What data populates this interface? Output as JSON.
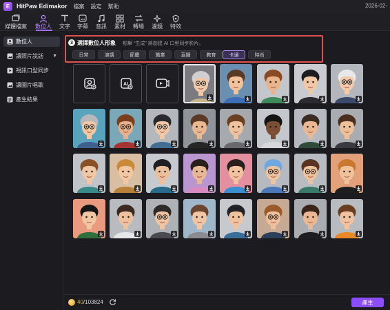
{
  "app": {
    "title": "HitPaw Edimakor",
    "logo_icon": "edimakor-logo",
    "date": "2026-02-"
  },
  "menu": [
    "檔案",
    "設定",
    "幫助"
  ],
  "toolbar": [
    {
      "label": "媒體檔案",
      "icon": "media-files-icon"
    },
    {
      "label": "數位人",
      "icon": "digital-human-icon",
      "active": true
    },
    {
      "label": "文字",
      "icon": "text-icon"
    },
    {
      "label": "字幕",
      "icon": "subtitles-icon"
    },
    {
      "label": "音訊",
      "icon": "audio-icon"
    },
    {
      "label": "素材",
      "icon": "assets-icon"
    },
    {
      "label": "轉場",
      "icon": "transitions-icon"
    },
    {
      "label": "濾鏡",
      "icon": "filters-icon"
    },
    {
      "label": "特效",
      "icon": "effects-icon"
    }
  ],
  "sidebar": [
    {
      "label": "數位人",
      "icon": "digital-human-icon",
      "active": true
    },
    {
      "label": "讓照片說話",
      "icon": "talking-photo-icon",
      "has_caret": true
    },
    {
      "label": "視訊口型同步",
      "icon": "lip-sync-icon"
    },
    {
      "label": "讓圖片唱歌",
      "icon": "singing-photo-icon"
    },
    {
      "label": "產生結果",
      "icon": "results-icon"
    }
  ],
  "selection": {
    "step": "3",
    "title": "選擇數位人形象",
    "hint": "點擊 \"生成\" 將創建 AI 口型同步影片。",
    "categories": [
      {
        "label": "日常"
      },
      {
        "label": "演講"
      },
      {
        "label": "節慶"
      },
      {
        "label": "職業"
      },
      {
        "label": "直播"
      },
      {
        "label": "教育"
      },
      {
        "label": "卡通",
        "active": true
      },
      {
        "label": "時尚"
      }
    ]
  },
  "upload_tiles": [
    {
      "icon": "upload-portrait-icon"
    },
    {
      "icon": "text-to-avatar-icon"
    },
    {
      "icon": "video-avatar-icon"
    }
  ],
  "avatars": [
    {
      "bg": "#7a7a80",
      "skin": "#f1c9a8",
      "hair": "#cfcfd2",
      "shirt": "#c8b68a",
      "glasses": true,
      "selected": true
    },
    {
      "bg": "#6a8fb0",
      "skin": "#f2c39b",
      "hair": "#5a3a24",
      "shirt": "#3c6fb8",
      "glasses": false
    },
    {
      "bg": "#c3c6cb",
      "skin": "#e8b48c",
      "hair": "#8a4a24",
      "shirt": "#3e8a5a",
      "glasses": false
    },
    {
      "bg": "#c9cbd0",
      "skin": "#f0c8a6",
      "hair": "#1c1c20",
      "shirt": "#2b2b30",
      "glasses": false
    },
    {
      "bg": "#b3b7bd",
      "skin": "#f2c9ab",
      "hair": "#e8e8ea",
      "shirt": "#3b4a6a",
      "glasses": true
    },
    {
      "bg": "#5aa3bd",
      "skin": "#f1c7a4",
      "hair": "#b8b8bc",
      "shirt": "#3e5f8f",
      "glasses": true
    },
    {
      "bg": "#7aa8b8",
      "skin": "#e7b08c",
      "hair": "#7a3f1e",
      "shirt": "#a53535",
      "glasses": true
    },
    {
      "bg": "#b4b8bd",
      "skin": "#f0c8a8",
      "hair": "#2a2a2e",
      "shirt": "#3f6e92",
      "glasses": true
    },
    {
      "bg": "#909498",
      "skin": "#e9b890",
      "hair": "#5a3a26",
      "shirt": "#262626",
      "glasses": false
    },
    {
      "bg": "#a6aaaf",
      "skin": "#eec29e",
      "hair": "#6a3f24",
      "shirt": "#6a6a6e",
      "glasses": false
    },
    {
      "bg": "#c4c7cc",
      "skin": "#7a4e34",
      "hair": "#151515",
      "shirt": "#d8d8da",
      "glasses": false
    },
    {
      "bg": "#b6bac0",
      "skin": "#eab994",
      "hair": "#3b2b22",
      "shirt": "#2f4b3a",
      "glasses": false
    },
    {
      "bg": "#a9adb2",
      "skin": "#eec09a",
      "hair": "#4a2f20",
      "shirt": "#3a3a40",
      "glasses": false
    },
    {
      "bg": "#c0c3c8",
      "skin": "#f0c7a4",
      "hair": "#8a5026",
      "shirt": "#3a8a8a",
      "glasses": false
    },
    {
      "bg": "#d8bfa4",
      "skin": "#f1c6a2",
      "hair": "#c98a3a",
      "shirt": "#b8813a",
      "glasses": false
    },
    {
      "bg": "#c7cace",
      "skin": "#ecbf9c",
      "hair": "#1f1f22",
      "shirt": "#2a6a8a",
      "glasses": false
    },
    {
      "bg": "#b996d0",
      "skin": "#e8b894",
      "hair": "#2a1f1a",
      "shirt": "#d98ac0",
      "glasses": false
    },
    {
      "bg": "#e48f9f",
      "skin": "#f0c2a0",
      "hair": "#2a1f1f",
      "shirt": "#3a8fd1",
      "glasses": false
    },
    {
      "bg": "#b6bac0",
      "skin": "#eec3a2",
      "hair": "#6fa8e0",
      "shirt": "#4a78b8",
      "glasses": true
    },
    {
      "bg": "#b8bcc1",
      "skin": "#eec19e",
      "hair": "#5a3422",
      "shirt": "#3a7a6a",
      "glasses": true
    },
    {
      "bg": "#e3a17b",
      "skin": "#f0c29c",
      "hair": "#c9782e",
      "shirt": "#1e1e1e",
      "glasses": false
    },
    {
      "bg": "#e99a7f",
      "skin": "#f1c6a3",
      "hair": "#161616",
      "shirt": "#2f6f3e",
      "glasses": false
    },
    {
      "bg": "#b8bcc1",
      "skin": "#eec29f",
      "hair": "#3a2a22",
      "shirt": "#e6e6e8",
      "glasses": false
    },
    {
      "bg": "#aeb2b7",
      "skin": "#efc4a2",
      "hair": "#2e2a26",
      "shirt": "#4a4a50",
      "glasses": true
    },
    {
      "bg": "#9fb7c9",
      "skin": "#f0c6a4",
      "hair": "#6a4430",
      "shirt": "#8a8a90",
      "glasses": false
    },
    {
      "bg": "#c6c9ce",
      "skin": "#efc3a0",
      "hair": "#222226",
      "shirt": "#3b6f9b",
      "glasses": false
    },
    {
      "bg": "#c7aa94",
      "skin": "#eec09c",
      "hair": "#9a5a2a",
      "shirt": "#2d3f5a",
      "glasses": true
    },
    {
      "bg": "#a9adb2",
      "skin": "#eab892",
      "hair": "#3a2418",
      "shirt": "#1e1e22",
      "glasses": false
    },
    {
      "bg": "#b8bcc1",
      "skin": "#efc3a2",
      "hair": "#6a3c20",
      "shirt": "#e88a2a",
      "glasses": false
    }
  ],
  "footer": {
    "credits_used": "40",
    "credits_total": "/103824",
    "coin_icon": "coin-icon",
    "refresh_icon": "refresh-icon",
    "generate_label": "產生"
  },
  "colors": {
    "accent": "#8b4dff",
    "accent_light": "#b78cff",
    "highlight_border": "#e05252",
    "background": "#1c1c20"
  }
}
